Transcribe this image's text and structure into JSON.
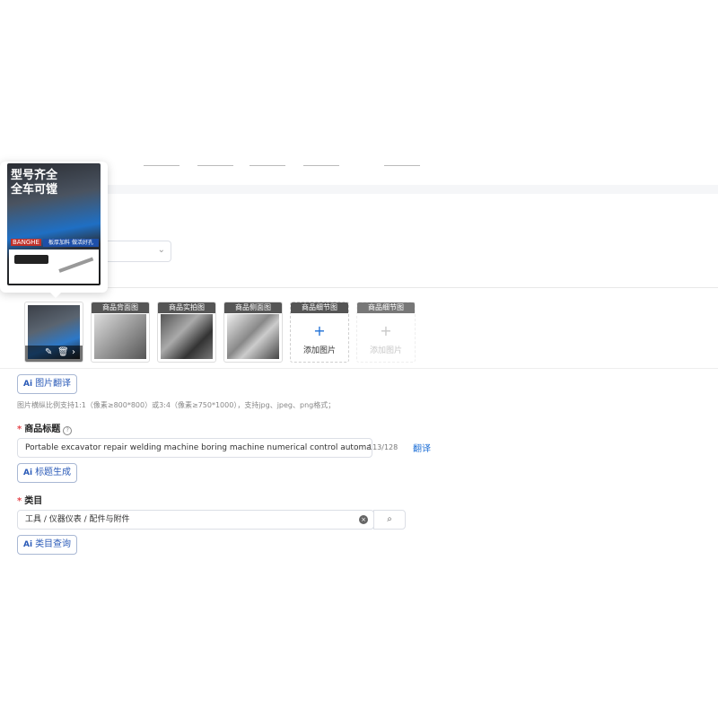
{
  "preview_popup": {
    "headline_1": "型号齐全",
    "headline_2": "全车可镗",
    "brand": "BANGHE",
    "promo": "板厚加料 做活好孔"
  },
  "image_slots": [
    {
      "caption": "",
      "type": "image"
    },
    {
      "caption": "商品背面图",
      "type": "image"
    },
    {
      "caption": "商品实拍图",
      "type": "image"
    },
    {
      "caption": "商品侧面图",
      "type": "image"
    },
    {
      "caption": "商品细节图",
      "type": "add",
      "add_label": "添加图片"
    },
    {
      "caption": "商品细节图",
      "type": "add-disabled",
      "add_label": "添加图片"
    }
  ],
  "first_slot_overlay": {
    "edit_icon": "edit-icon",
    "delete_icon": "trash-icon",
    "next_icon": "chevron-right-icon"
  },
  "image_translate_button": {
    "ai": "Ai",
    "label": "图片翻译"
  },
  "image_hint": "图片横纵比例支持1:1（像素≥800*800）或3:4（像素≥750*1000），支持jpg、jpeg、png格式；",
  "title_section": {
    "label": "商品标题",
    "required": "*",
    "input_value": "Portable excavator repair welding machine boring machine numerical control automatic bor",
    "counter": "113/128",
    "translate_link": "翻译",
    "ai_button": {
      "ai": "Ai",
      "label": "标题生成"
    }
  },
  "category_section": {
    "label": "类目",
    "required": "*",
    "input_value": "工具 / 仪器仪表 / 配件与附件",
    "ai_button": {
      "ai": "Ai",
      "label": "类目查询"
    }
  },
  "colors": {
    "accent": "#1d6fd6",
    "required": "#e5484d"
  }
}
